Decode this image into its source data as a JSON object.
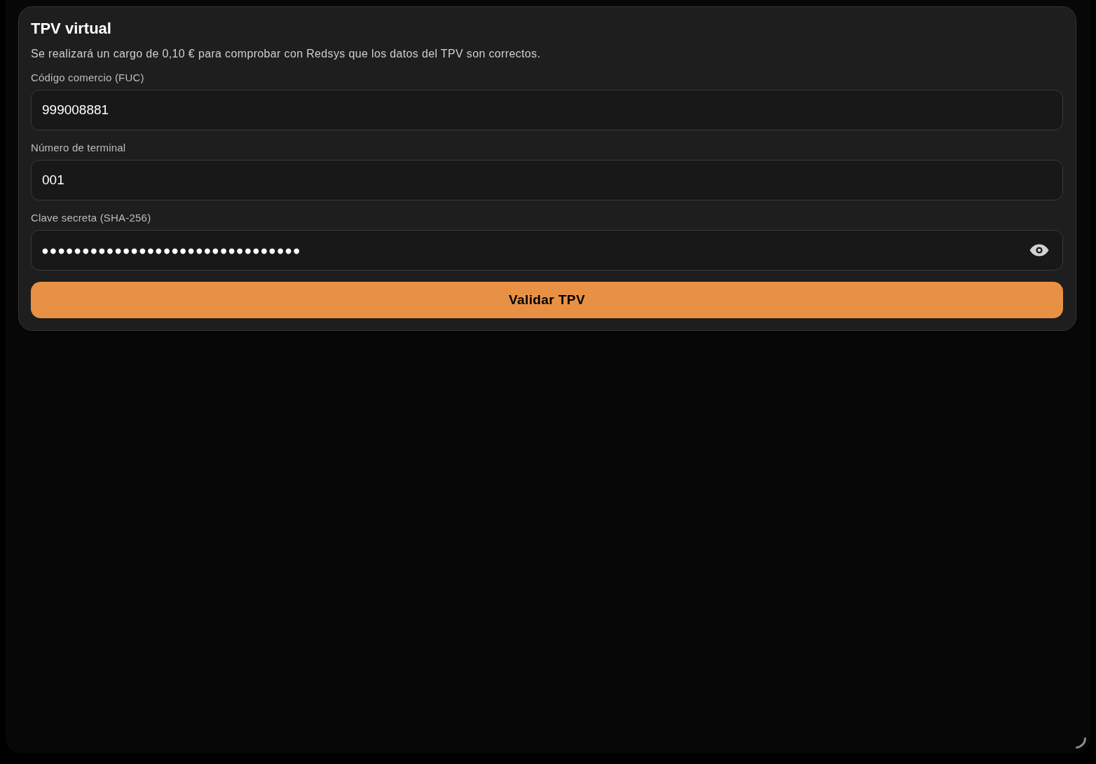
{
  "card": {
    "title": "TPV virtual",
    "description": "Se realizará un cargo de 0,10 € para comprobar con Redsys que los datos del TPV son correctos.",
    "fields": [
      {
        "kind": "text",
        "label": "Código comercio (FUC)",
        "value": "999008881"
      },
      {
        "kind": "text",
        "label": "Número de terminal",
        "value": "001"
      },
      {
        "kind": "password",
        "label": "Clave secreta (SHA-256)",
        "value": "●●●●●●●●●●●●●●●●●●●●●●●●●●●●●●●●"
      }
    ],
    "submit_button": "Validar TPV"
  }
}
